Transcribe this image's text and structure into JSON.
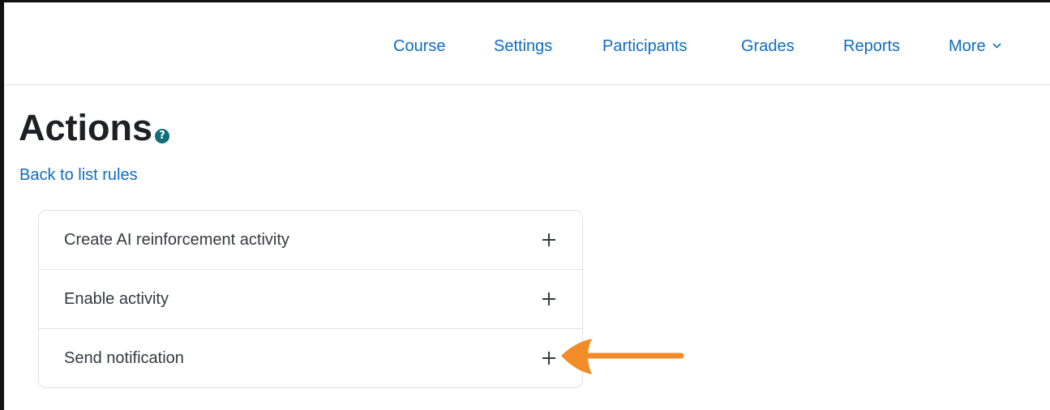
{
  "nav": {
    "items": [
      "Course",
      "Settings",
      "Participants",
      "Grades",
      "Reports"
    ],
    "more_label": "More"
  },
  "page": {
    "title": "Actions",
    "help_icon": "question-circle-icon",
    "back_link": "Back to list rules"
  },
  "actions": [
    {
      "label": "Create AI reinforcement activity",
      "icon": "plus-icon"
    },
    {
      "label": "Enable activity",
      "icon": "plus-icon"
    },
    {
      "label": "Send notification",
      "icon": "plus-icon"
    }
  ],
  "annotation": {
    "icon": "arrow-left-icon",
    "color": "#f28c28"
  },
  "colors": {
    "link": "#0f6cbf",
    "help": "#0f6e7a",
    "border": "#dee2e6"
  }
}
